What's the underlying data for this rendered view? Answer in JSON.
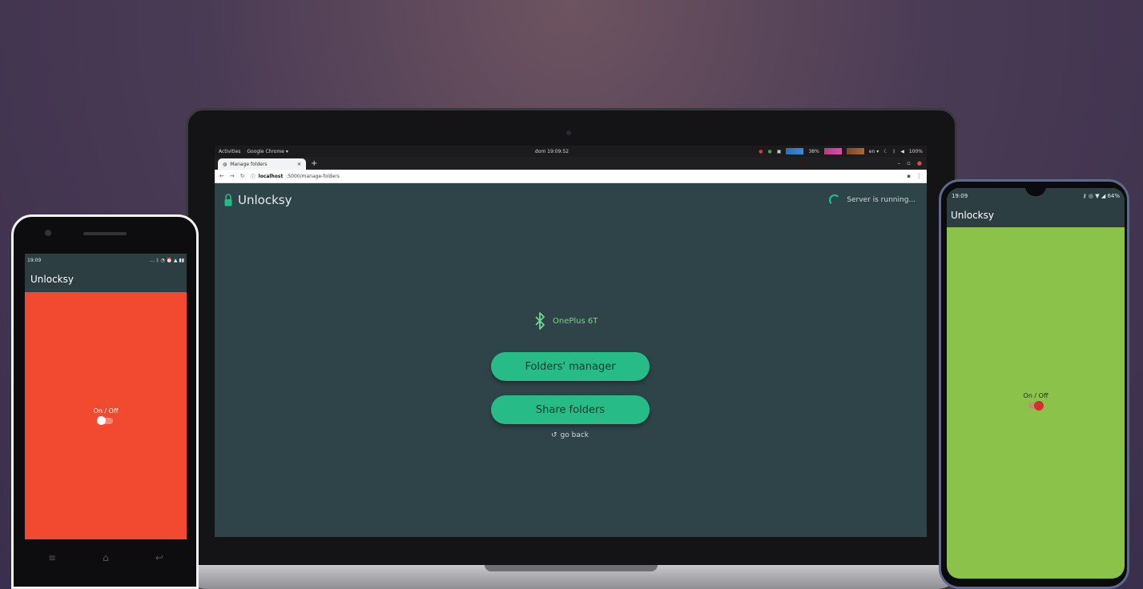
{
  "laptop": {
    "topbar": {
      "activities": "Activities",
      "app_menu": "Google Chrome ▾",
      "clock": "dom 19:09:52",
      "cpu": "38%",
      "lang": "en ▾",
      "battery": "100%"
    },
    "browser": {
      "tab_title": "Manage folders",
      "url_host": "localhost",
      "url_path": ":5000/manage-folders"
    },
    "app": {
      "title": "Unlocksy",
      "server_status": "Server is running...",
      "device_name": "OnePlus 6T",
      "buttons": {
        "folders_manager": "Folders' manager",
        "share_folders": "Share folders"
      },
      "go_back": "go back"
    }
  },
  "phone_left": {
    "status_time": "19:09",
    "app_title": "Unlocksy",
    "toggle_label": "On / Off",
    "toggle_on": false,
    "background_color": "#f24a30"
  },
  "phone_right": {
    "status_time": "19:09",
    "battery": "64%",
    "app_title": "Unlocksy",
    "toggle_label": "On / Off",
    "toggle_on": true,
    "background_color": "#8bc34a"
  },
  "colors": {
    "app_bg": "#2f4449",
    "accent_green": "#26bb87",
    "bluetooth_green": "#6fd68a"
  }
}
